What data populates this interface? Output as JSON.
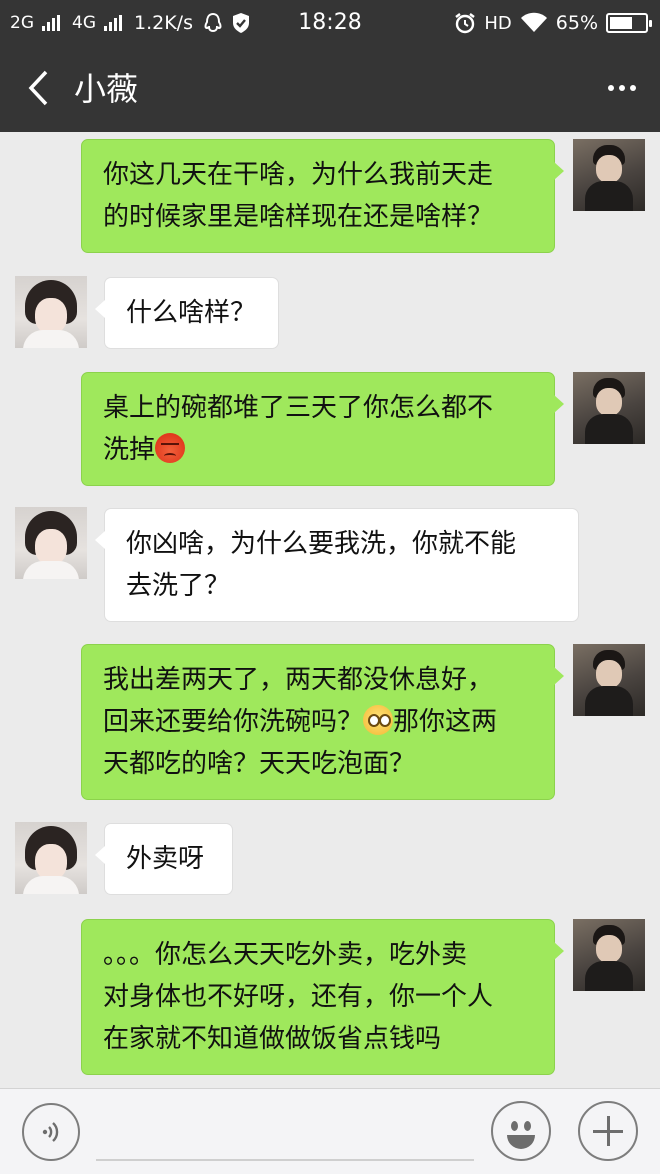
{
  "status_bar": {
    "network_1": "2G",
    "network_2": "4G",
    "speed": "1.2K/s",
    "time": "18:28",
    "hd": "HD",
    "battery_text": "65%",
    "battery_level": 0.65
  },
  "nav": {
    "title": "小薇",
    "back_icon": "chevron-left-icon",
    "more_icon": "more-dots-icon"
  },
  "messages": [
    {
      "side": "me",
      "lines": [
        "你这几天在干啥，为什么我前天走",
        "的时候家里是啥样现在还是啥样？"
      ]
    },
    {
      "side": "her",
      "lines": [
        "什么啥样？"
      ]
    },
    {
      "side": "me",
      "lines": [
        "桌上的碗都堆了三天了你怎么都不",
        "洗掉"
      ],
      "emoji": "angry-face-emoji"
    },
    {
      "side": "her",
      "lines": [
        "你凶啥，为什么要我洗，你就不能",
        "去洗了？"
      ]
    },
    {
      "side": "me",
      "lines": [
        "我出差两天了，两天都没休息好，",
        "回来还要给你洗碗吗？",
        "那你这两",
        "天都吃的啥？天天吃泡面？"
      ],
      "emoji": "pleading-face-emoji"
    },
    {
      "side": "her",
      "lines": [
        "外卖呀"
      ]
    },
    {
      "side": "me",
      "lines": [
        "。。。你怎么天天吃外卖，吃外卖",
        "对身体也不好呀，还有，你一个人",
        "在家就不知道做做饭省点钱吗"
      ]
    }
  ],
  "input_bar": {
    "voice_icon": "voice-icon",
    "emoji_icon": "emoji-icon",
    "plus_icon": "plus-icon"
  },
  "colors": {
    "nav_bg": "#353535",
    "chat_bg": "#ebebeb",
    "my_bubble": "#9fe85c",
    "their_bubble": "#ffffff"
  }
}
